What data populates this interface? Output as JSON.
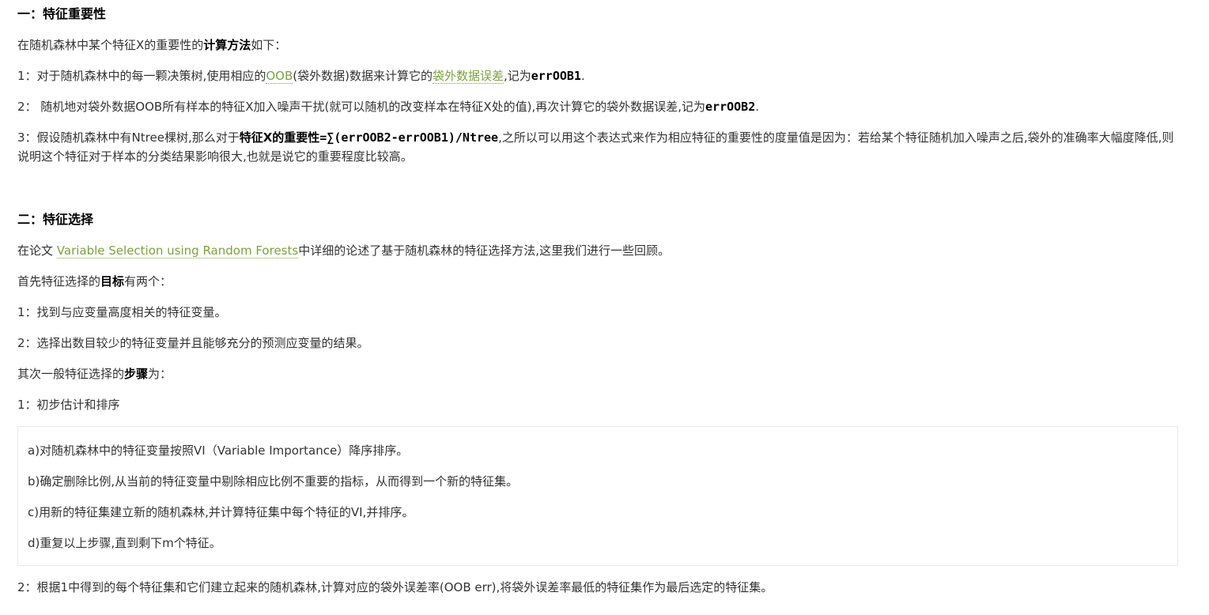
{
  "section1": {
    "heading": "一：特征重要性",
    "intro": {
      "pre": "在随机森林中某个特征X的重要性的",
      "bold": "计算方法",
      "post": "如下："
    },
    "step1": {
      "pre": "1：对于随机森林中的每一颗决策树,使用相应的",
      "link1": "OOB",
      "mid": "(袋外数据)数据来计算它的",
      "link2": "袋外数据误差",
      "mid2": ",记为",
      "bold": "errOOB1",
      "post": "."
    },
    "step2": {
      "pre": "2： 随机地对袋外数据OOB所有样本的特征X加入噪声干扰(就可以随机的改变样本在特征X处的值),再次计算它的袋外数据误差,记为",
      "bold": "errOOB2",
      "post": "."
    },
    "step3": {
      "pre": "3：假设随机森林中有Ntree棵树,那么对于",
      "bold1": "特征X的重要性",
      "bold2": "=∑(errOOB2-errOOB1)/Ntree",
      "post": ",之所以可以用这个表达式来作为相应特征的重要性的度量值是因为：若给某个特征随机加入噪声之后,袋外的准确率大幅度降低,则说明这个特征对于样本的分类结果影响很大,也就是说它的重要程度比较高。"
    }
  },
  "section2": {
    "heading": "二：特征选择",
    "paper": {
      "pre": "在论文 ",
      "link": "Variable Selection using Random Forests",
      "post": "中详细的论述了基于随机森林的特征选择方法,这里我们进行一些回顾。"
    },
    "goals_intro": {
      "pre": "首先特征选择的",
      "bold": "目标",
      "post": "有两个："
    },
    "goal1": "1：找到与应变量高度相关的特征变量。",
    "goal2": "2：选择出数目较少的特征变量并且能够充分的预测应变量的结果。",
    "steps_intro": {
      "pre": "其次一般特征选择的",
      "bold": "步骤",
      "post": "为："
    },
    "step1": "1：初步估计和排序",
    "substeps": [
      "a)对随机森林中的特征变量按照VI（Variable Importance）降序排序。",
      "b)确定删除比例,从当前的特征变量中剔除相应比例不重要的指标，从而得到一个新的特征集。",
      "c)用新的特征集建立新的随机森林,并计算特征集中每个特征的VI,并排序。",
      "d)重复以上步骤,直到剩下m个特征。"
    ],
    "step2": "2：根据1中得到的每个特征集和它们建立起来的随机森林,计算对应的袋外误差率(OOB err),将袋外误差率最低的特征集作为最后选定的特征集。"
  }
}
